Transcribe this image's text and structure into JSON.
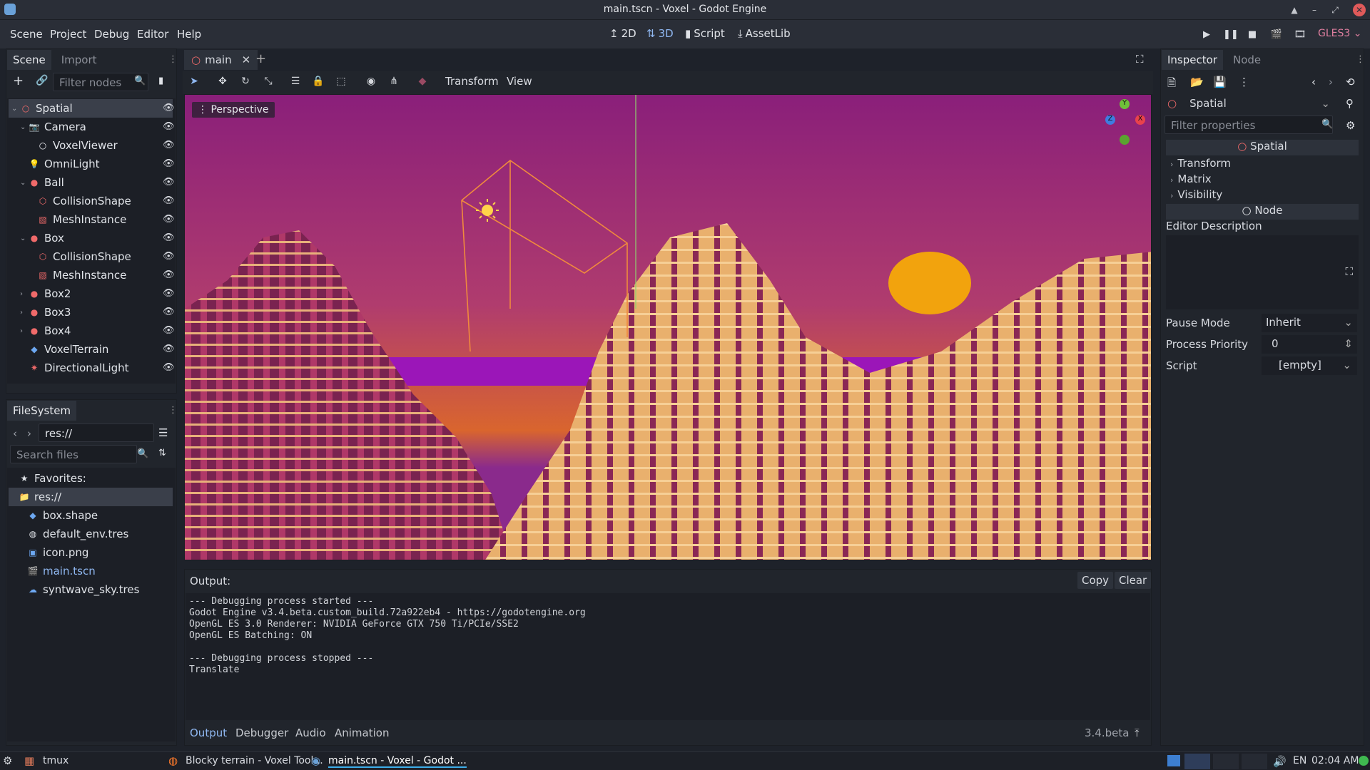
{
  "window": {
    "title": "main.tscn - Voxel - Godot Engine"
  },
  "menu": [
    "Scene",
    "Project",
    "Debug",
    "Editor",
    "Help"
  ],
  "modes": [
    {
      "label": "2D",
      "icon": "2d-icon"
    },
    {
      "label": "3D",
      "icon": "3d-icon",
      "active": true
    },
    {
      "label": "Script",
      "icon": "script-icon"
    },
    {
      "label": "AssetLib",
      "icon": "assetlib-icon"
    }
  ],
  "renderer": "GLES3",
  "scene_dock": {
    "tabs": [
      "Scene",
      "Import"
    ],
    "filter_placeholder": "Filter nodes",
    "nodes": [
      {
        "label": "Spatial",
        "depth": 0,
        "arrow": "v",
        "icon": "○",
        "color": "#f06a6a",
        "selected": true
      },
      {
        "label": "Camera",
        "depth": 1,
        "arrow": "v",
        "icon": "📷",
        "color": "#f06a6a"
      },
      {
        "label": "VoxelViewer",
        "depth": 2,
        "arrow": "",
        "icon": "○",
        "color": "#e8eaee"
      },
      {
        "label": "OmniLight",
        "depth": 1,
        "arrow": "",
        "icon": "💡",
        "color": "#f06a6a"
      },
      {
        "label": "Ball",
        "depth": 1,
        "arrow": "v",
        "icon": "●",
        "color": "#f06a6a"
      },
      {
        "label": "CollisionShape",
        "depth": 2,
        "arrow": "",
        "icon": "⬡",
        "color": "#f06a6a"
      },
      {
        "label": "MeshInstance",
        "depth": 2,
        "arrow": "",
        "icon": "▧",
        "color": "#f06a6a"
      },
      {
        "label": "Box",
        "depth": 1,
        "arrow": "v",
        "icon": "●",
        "color": "#f06a6a"
      },
      {
        "label": "CollisionShape",
        "depth": 2,
        "arrow": "",
        "icon": "⬡",
        "color": "#f06a6a"
      },
      {
        "label": "MeshInstance",
        "depth": 2,
        "arrow": "",
        "icon": "▧",
        "color": "#f06a6a"
      },
      {
        "label": "Box2",
        "depth": 1,
        "arrow": ">",
        "icon": "●",
        "color": "#f06a6a"
      },
      {
        "label": "Box3",
        "depth": 1,
        "arrow": ">",
        "icon": "●",
        "color": "#f06a6a"
      },
      {
        "label": "Box4",
        "depth": 1,
        "arrow": ">",
        "icon": "●",
        "color": "#f06a6a"
      },
      {
        "label": "VoxelTerrain",
        "depth": 1,
        "arrow": "",
        "icon": "◆",
        "color": "#6da8f2"
      },
      {
        "label": "DirectionalLight",
        "depth": 1,
        "arrow": "",
        "icon": "✷",
        "color": "#f06a6a"
      }
    ]
  },
  "filesystem": {
    "tab": "FileSystem",
    "path": "res://",
    "search_placeholder": "Search files",
    "items": [
      {
        "label": "Favorites:",
        "depth": 0,
        "icon": "★",
        "color": "#e1e4e9"
      },
      {
        "label": "res://",
        "depth": 0,
        "icon": "📁",
        "color": "#8fb7f0",
        "selected": true
      },
      {
        "label": "box.shape",
        "depth": 1,
        "icon": "◆",
        "color": "#6da8f2"
      },
      {
        "label": "default_env.tres",
        "depth": 1,
        "icon": "◍",
        "color": "#e1e4e9"
      },
      {
        "label": "icon.png",
        "depth": 1,
        "icon": "▣",
        "color": "#6da8f2"
      },
      {
        "label": "main.tscn",
        "depth": 1,
        "icon": "🎬",
        "color": "#8fb7f0",
        "highlight": true
      },
      {
        "label": "syntwave_sky.tres",
        "depth": 1,
        "icon": "☁",
        "color": "#6da8f2"
      }
    ]
  },
  "editor_tab": {
    "label": "main"
  },
  "viewport": {
    "toolbar": [
      "Transform",
      "View"
    ],
    "perspective": "Perspective",
    "gizmo": {
      "y": "Y",
      "x": "X",
      "z": "Z"
    }
  },
  "inspector": {
    "tabs": [
      "Inspector",
      "Node"
    ],
    "object": "Spatial",
    "filter_placeholder": "Filter properties",
    "sections": {
      "spatial": "Spatial",
      "node": "Node"
    },
    "groups": [
      "Transform",
      "Matrix",
      "Visibility"
    ],
    "editor_description": "Editor Description",
    "props": [
      {
        "name": "Pause Mode",
        "value": "Inherit"
      },
      {
        "name": "Process Priority",
        "value": "0"
      },
      {
        "name": "Script",
        "value": "[empty]"
      }
    ]
  },
  "output": {
    "label": "Output:",
    "copy": "Copy",
    "clear": "Clear",
    "lines": [
      "--- Debugging process started ---",
      "Godot Engine v3.4.beta.custom_build.72a922eb4 - https://godotengine.org",
      "OpenGL ES 3.0 Renderer: NVIDIA GeForce GTX 750 Ti/PCIe/SSE2",
      "OpenGL ES Batching: ON",
      "",
      "--- Debugging process stopped ---",
      "Translate"
    ],
    "tabs": [
      "Output",
      "Debugger",
      "Audio",
      "Animation"
    ],
    "version": "3.4.beta"
  },
  "taskbar": {
    "items": [
      "tmux",
      "Blocky terrain - Voxel Tool...",
      "main.tscn - Voxel - Godot ..."
    ],
    "lang": "EN",
    "time": "02:04 AM"
  }
}
